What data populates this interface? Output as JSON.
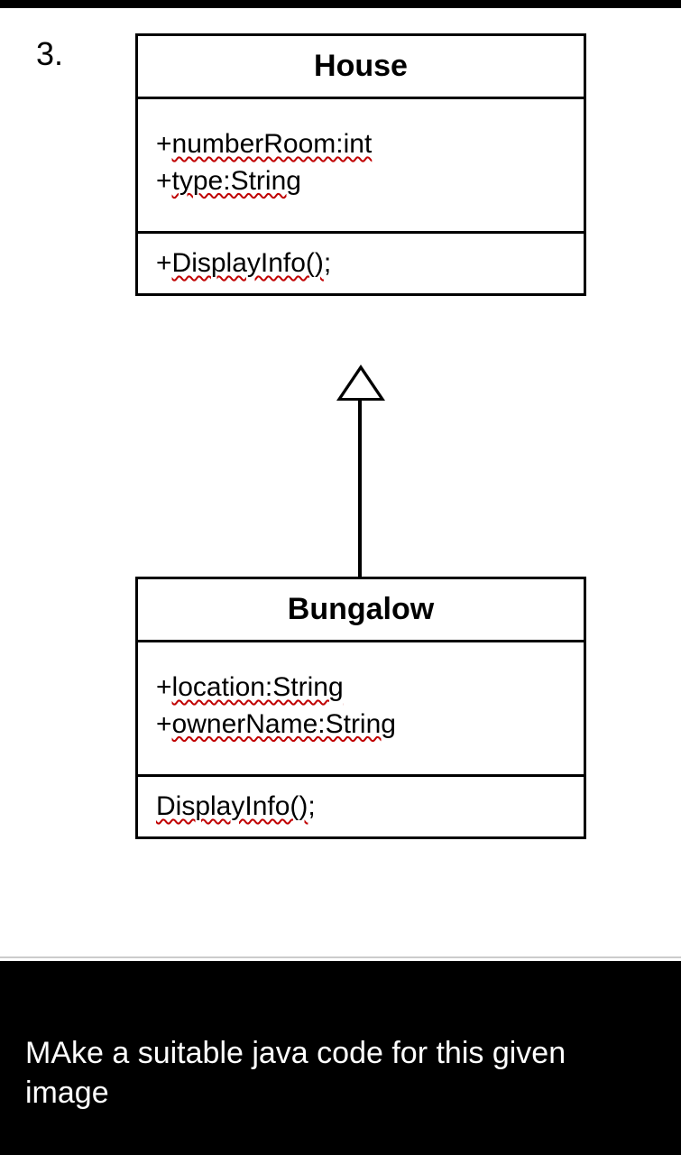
{
  "question_number": "3.",
  "house": {
    "title": "House",
    "attr1_plus": "+",
    "attr1_name": "numberRoom:int",
    "attr2_plus": "+",
    "attr2_name": "type:String",
    "method1_plus": "+",
    "method1_name": "DisplayInfo()",
    "method1_semi": ";"
  },
  "bungalow": {
    "title": "Bungalow",
    "attr1_plus": "+",
    "attr1_name": "location:String",
    "attr2_plus": "+",
    "attr2_name": "ownerName:String",
    "method1_name": "DisplayInfo()",
    "method1_semi": ";"
  },
  "footer": "MAke a suitable java code for this given image"
}
